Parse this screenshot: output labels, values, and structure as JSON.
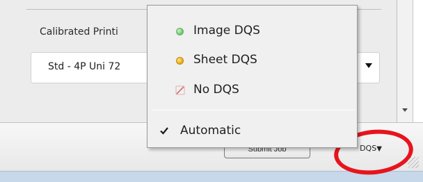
{
  "form": {
    "calibrated_label": "Calibrated Printi",
    "printer_select_value": "Std - 4P Uni 72"
  },
  "footer": {
    "submit_label": "Submit Job",
    "dqs_label": "DQS",
    "dqs_arrow": "▼"
  },
  "dqs_menu": {
    "items": [
      {
        "label": "Image DQS",
        "icon": "green-dot-icon",
        "color": "#5bc85b"
      },
      {
        "label": "Sheet DQS",
        "icon": "orange-dot-icon",
        "color": "#f0a800"
      },
      {
        "label": "No DQS",
        "icon": "no-dqs-slash-icon",
        "color": "#d98a8a"
      }
    ],
    "automatic": {
      "label": "Automatic",
      "checked": true,
      "icon": "checkmark-icon"
    }
  },
  "annotation": {
    "highlight_color": "#e8141c",
    "shape": "red-circle"
  }
}
